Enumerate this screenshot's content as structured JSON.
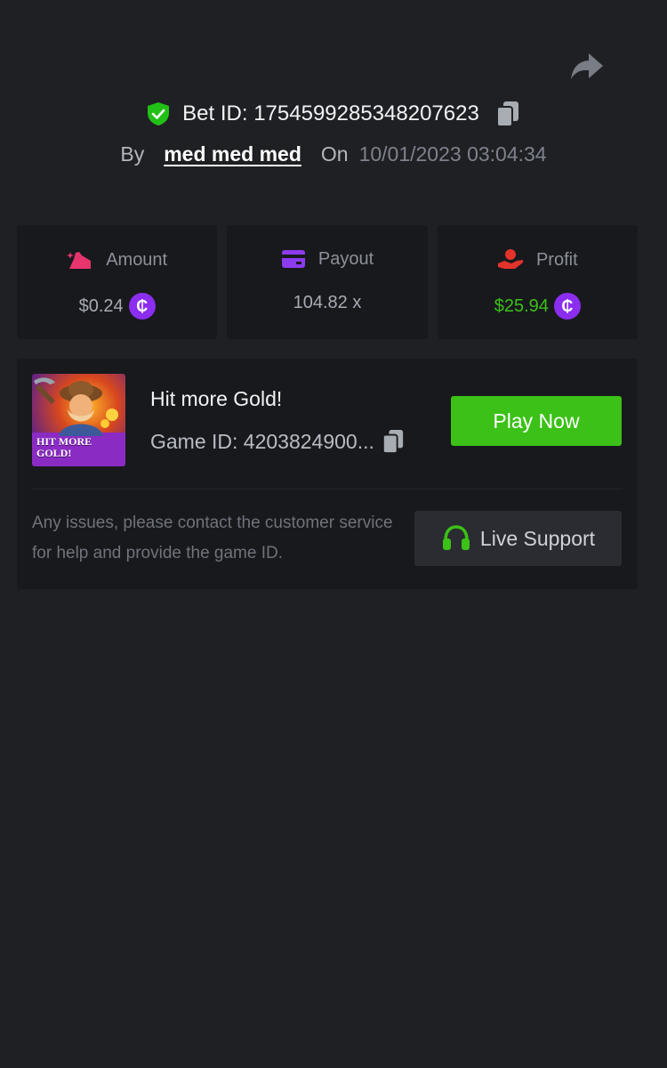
{
  "header": {
    "bet_id": "Bet ID: 1754599285348207623",
    "by_label": "By",
    "username": "med med med",
    "on_label": "On",
    "datetime": "10/01/2023 03:04:34"
  },
  "stats": {
    "amount": {
      "label": "Amount",
      "value": "$0.24",
      "icon": "money-bag-icon",
      "color": "#e8356d"
    },
    "payout": {
      "label": "Payout",
      "value": "104.82 x",
      "icon": "card-icon",
      "color": "#8d3bef"
    },
    "profit": {
      "label": "Profit",
      "value": "$25.94",
      "icon": "hand-coin-icon",
      "color": "#e2342b",
      "value_color": "#3bc117"
    }
  },
  "coin_symbol": "₵",
  "game": {
    "title": "Hit more Gold!",
    "game_id": "Game ID: 4203824900...",
    "thumb_text_line1": "HIT MORE",
    "thumb_text_line2": "GOLD!",
    "play_label": "Play Now"
  },
  "support": {
    "help_text": "Any issues, please contact the customer service for help and provide the game ID.",
    "button_label": "Live Support"
  },
  "colors": {
    "background": "#1f2024",
    "panel": "#18191d",
    "accent_green": "#3bc117",
    "coin_purple": "#8b2ef0"
  }
}
